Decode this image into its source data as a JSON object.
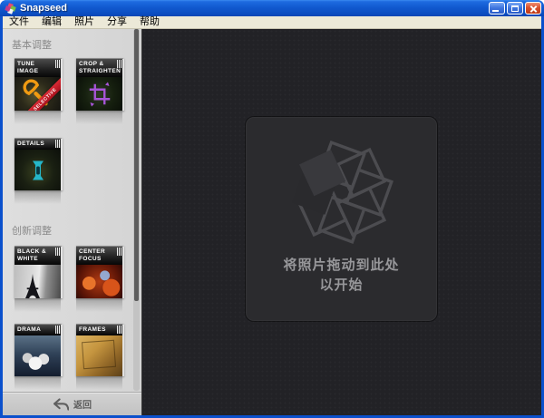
{
  "window": {
    "title": "Snapseed",
    "controls": [
      "minimize",
      "maximize",
      "close"
    ]
  },
  "menu": {
    "items": [
      "文件",
      "编辑",
      "照片",
      "分享",
      "帮助"
    ]
  },
  "sidebar": {
    "sections": [
      {
        "title": "基本调整",
        "tiles": [
          {
            "label": "TUNE IMAGE",
            "ribbon": "SELECTIVE",
            "icon": "wrench-icon"
          },
          {
            "label": "CROP & STRAIGHTEN",
            "icon": "crop-icon"
          },
          {
            "label": "DETAILS",
            "icon": "sharpener-icon"
          }
        ]
      },
      {
        "title": "创新调整",
        "tiles": [
          {
            "label": "BLACK & WHITE",
            "icon": "eiffel-tower-motif"
          },
          {
            "label": "CENTER FOCUS",
            "icon": "bokeh-motif"
          },
          {
            "label": "DRAMA",
            "icon": "clouds-motif"
          },
          {
            "label": "FRAMES",
            "icon": "paper-frame-motif"
          }
        ]
      }
    ],
    "back_label": "返回"
  },
  "main": {
    "dropzone_line1": "将照片拖动到此处",
    "dropzone_line2": "以开始"
  },
  "colors": {
    "titlebar_blue": "#1159cf",
    "ribbon_red": "#c8202e",
    "main_bg": "#222226",
    "dropzone_bg": "#2b2b2e"
  }
}
